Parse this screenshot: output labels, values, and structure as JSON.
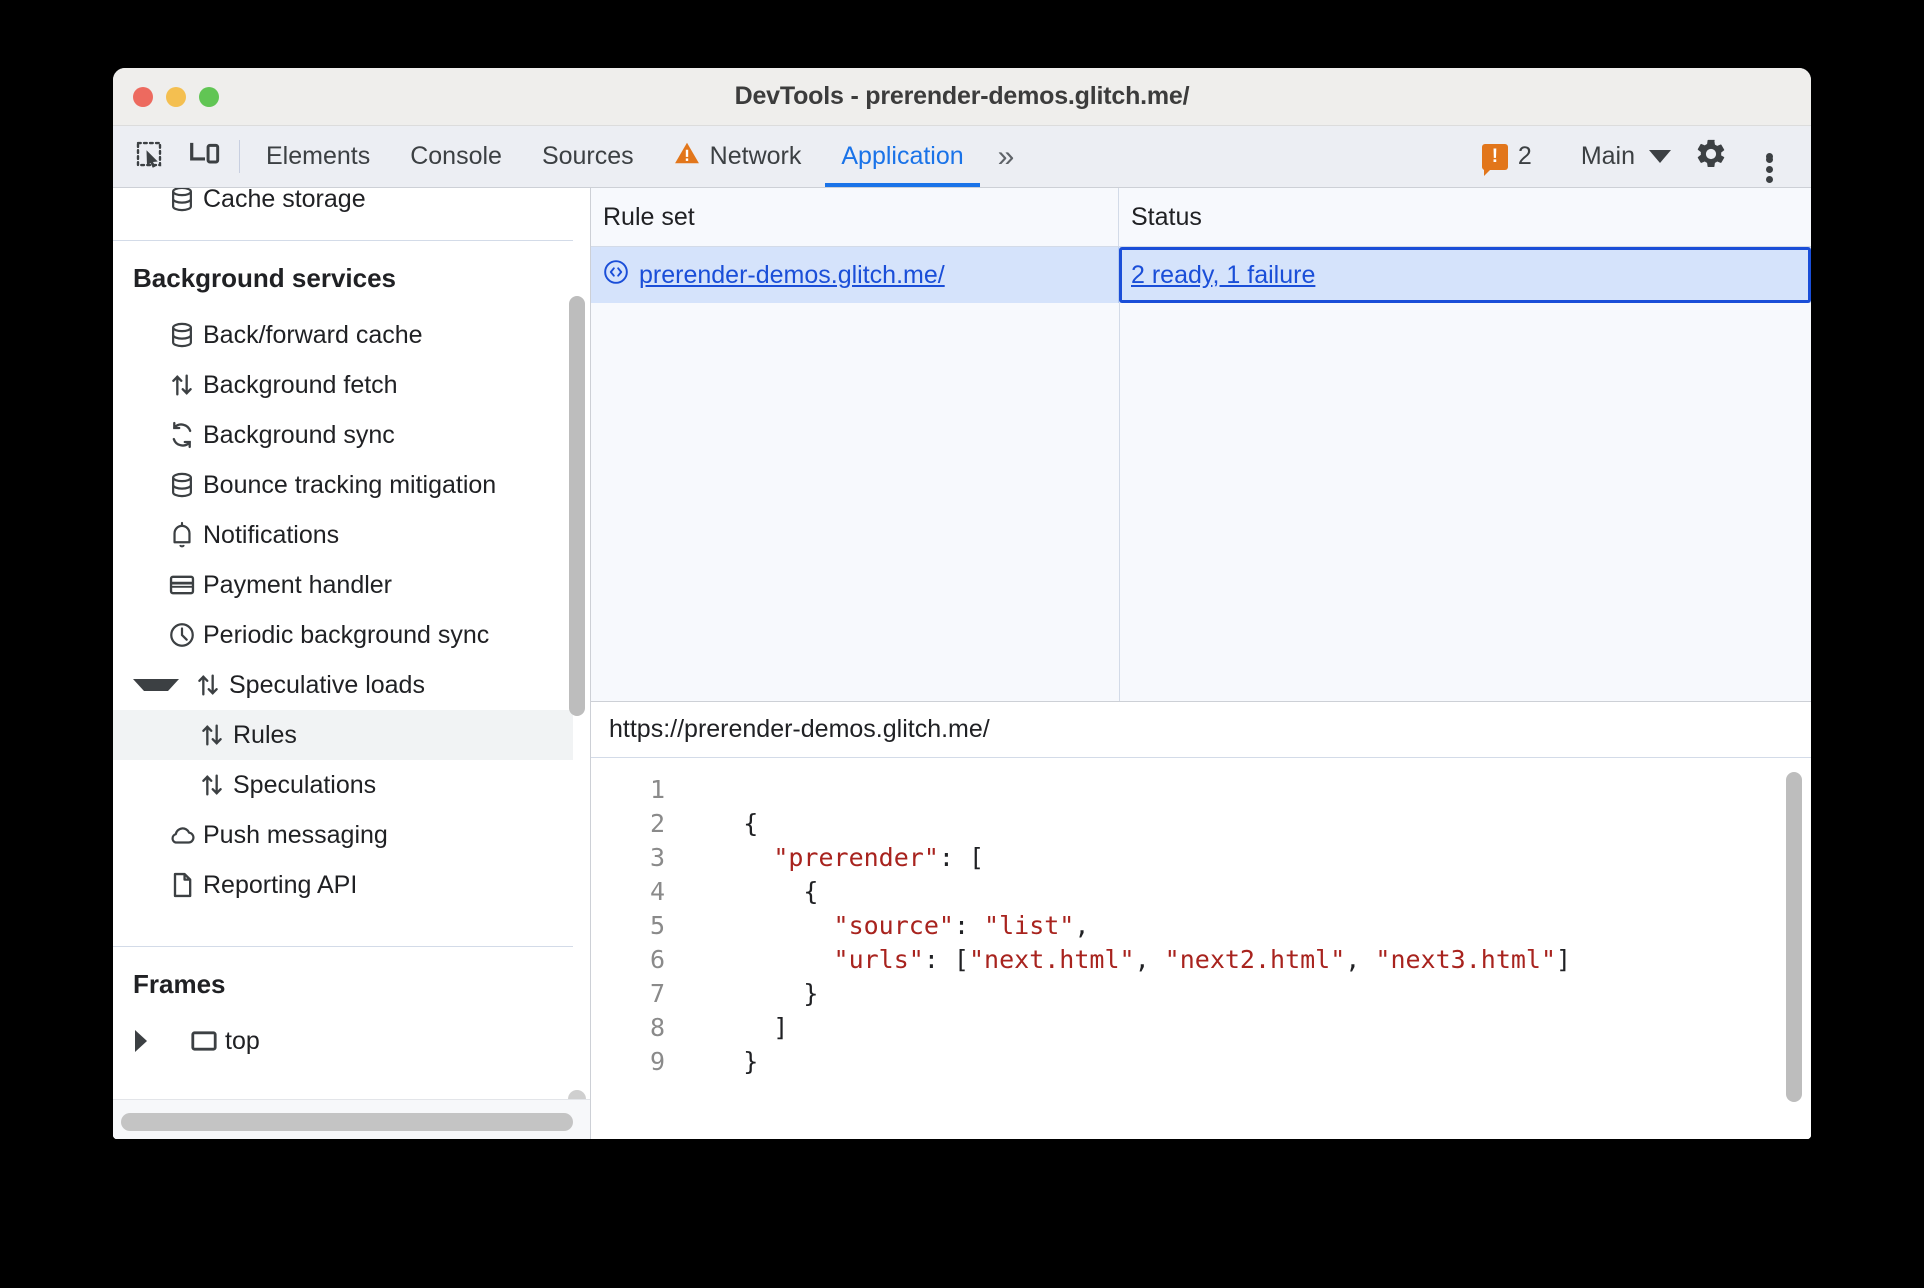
{
  "window": {
    "title": "DevTools - prerender-demos.glitch.me/",
    "traffic_lights": [
      "close",
      "minimize",
      "maximize"
    ]
  },
  "toolbar": {
    "inspect_icon": "inspect-element-icon",
    "device_icon": "device-toolbar-icon",
    "tabs": [
      {
        "label": "Elements",
        "selected": false,
        "warning": false
      },
      {
        "label": "Console",
        "selected": false,
        "warning": false
      },
      {
        "label": "Sources",
        "selected": false,
        "warning": false
      },
      {
        "label": "Network",
        "selected": false,
        "warning": true
      },
      {
        "label": "Application",
        "selected": true,
        "warning": false
      }
    ],
    "more_tabs_label": "»",
    "issues": {
      "count": "2",
      "badge_glyph": "!"
    },
    "context_label": "Main",
    "settings_icon": "gear-icon",
    "more_icon": "more-vertical-icon"
  },
  "sidebar": {
    "clipped_top_item": "Cache storage",
    "sections": [
      {
        "title": "Background services",
        "items": [
          {
            "label": "Back/forward cache",
            "icon": "database-icon",
            "indent": 1,
            "selected": false
          },
          {
            "label": "Background fetch",
            "icon": "arrows-up-down-icon",
            "indent": 1,
            "selected": false
          },
          {
            "label": "Background sync",
            "icon": "sync-icon",
            "indent": 1,
            "selected": false
          },
          {
            "label": "Bounce tracking mitigation",
            "icon": "database-icon",
            "indent": 1,
            "selected": false
          },
          {
            "label": "Notifications",
            "icon": "bell-icon",
            "indent": 1,
            "selected": false
          },
          {
            "label": "Payment handler",
            "icon": "credit-card-icon",
            "indent": 1,
            "selected": false
          },
          {
            "label": "Periodic background sync",
            "icon": "clock-icon",
            "indent": 1,
            "selected": false
          },
          {
            "label": "Speculative loads",
            "icon": "arrows-up-down-icon",
            "indent": 1,
            "selected": false,
            "twisty": "open"
          },
          {
            "label": "Rules",
            "icon": "arrows-up-down-icon",
            "indent": 2,
            "selected": true
          },
          {
            "label": "Speculations",
            "icon": "arrows-up-down-icon",
            "indent": 2,
            "selected": false
          },
          {
            "label": "Push messaging",
            "icon": "cloud-icon",
            "indent": 1,
            "selected": false
          },
          {
            "label": "Reporting API",
            "icon": "document-icon",
            "indent": 1,
            "selected": false
          }
        ]
      },
      {
        "title": "Frames",
        "items": [
          {
            "label": "top",
            "icon": "frame-icon",
            "indent": 1,
            "selected": false,
            "twisty": "closed"
          }
        ]
      }
    ]
  },
  "rules_grid": {
    "columns": [
      "Rule set",
      "Status"
    ],
    "rows": [
      {
        "rule_set": "prerender-demos.glitch.me/",
        "rule_set_icon": "code-brackets-icon",
        "status": "2 ready, 1 failure",
        "selected": true,
        "status_focused": true
      }
    ]
  },
  "code_panel": {
    "url": "https://prerender-demos.glitch.me/",
    "lines": [
      {
        "n": "1",
        "segments": []
      },
      {
        "n": "2",
        "segments": [
          {
            "t": "    {",
            "c": "code-text"
          }
        ]
      },
      {
        "n": "3",
        "segments": [
          {
            "t": "      ",
            "c": "code-text"
          },
          {
            "t": "\"prerender\"",
            "c": "str"
          },
          {
            "t": ": [",
            "c": "code-text"
          }
        ]
      },
      {
        "n": "4",
        "segments": [
          {
            "t": "        {",
            "c": "code-text"
          }
        ]
      },
      {
        "n": "5",
        "segments": [
          {
            "t": "          ",
            "c": "code-text"
          },
          {
            "t": "\"source\"",
            "c": "str"
          },
          {
            "t": ": ",
            "c": "code-text"
          },
          {
            "t": "\"list\"",
            "c": "str"
          },
          {
            "t": ",",
            "c": "code-text"
          }
        ]
      },
      {
        "n": "6",
        "segments": [
          {
            "t": "          ",
            "c": "code-text"
          },
          {
            "t": "\"urls\"",
            "c": "str"
          },
          {
            "t": ": [",
            "c": "code-text"
          },
          {
            "t": "\"next.html\"",
            "c": "str"
          },
          {
            "t": ", ",
            "c": "code-text"
          },
          {
            "t": "\"next2.html\"",
            "c": "str"
          },
          {
            "t": ", ",
            "c": "code-text"
          },
          {
            "t": "\"next3.html\"",
            "c": "str"
          },
          {
            "t": "]",
            "c": "code-text"
          }
        ]
      },
      {
        "n": "7",
        "segments": [
          {
            "t": "        }",
            "c": "code-text"
          }
        ]
      },
      {
        "n": "8",
        "segments": [
          {
            "t": "      ]",
            "c": "code-text"
          }
        ]
      },
      {
        "n": "9",
        "segments": [
          {
            "t": "    }",
            "c": "code-text"
          }
        ]
      }
    ]
  },
  "colors": {
    "accent": "#1a73e8",
    "link": "#1a4ed8",
    "selection": "#d5e3fb",
    "warning": "#e2761b",
    "string": "#a8231e"
  }
}
